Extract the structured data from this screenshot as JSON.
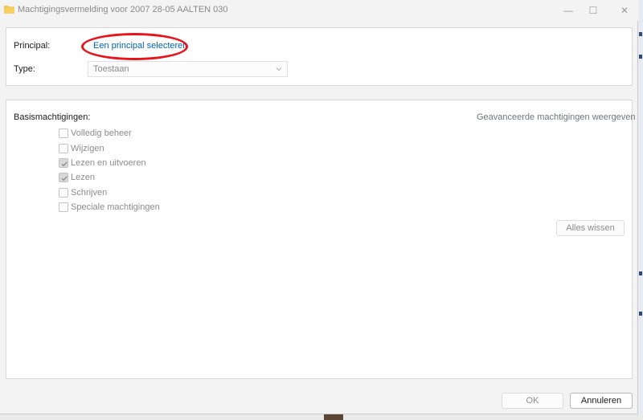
{
  "window": {
    "title": "Machtigingsvermelding voor 2007 28-05 AALTEN 030",
    "minimize_glyph": "—",
    "maximize_glyph": "☐",
    "close_glyph": "✕"
  },
  "principal": {
    "label": "Principal:",
    "link": "Een principal selecteren"
  },
  "type": {
    "label": "Type:",
    "value": "Toestaan"
  },
  "permissions": {
    "heading": "Basismachtigingen:",
    "advanced_link": "Geavanceerde machtigingen weergeven",
    "items": [
      {
        "label": "Volledig beheer",
        "checked": false
      },
      {
        "label": "Wijzigen",
        "checked": false
      },
      {
        "label": "Lezen en uitvoeren",
        "checked": true
      },
      {
        "label": "Lezen",
        "checked": true
      },
      {
        "label": "Schrijven",
        "checked": false
      },
      {
        "label": "Speciale machtigingen",
        "checked": false
      }
    ],
    "clear_button": "Alles wissen"
  },
  "footer": {
    "ok_label": "OK",
    "cancel_label": "Annuleren"
  },
  "colors": {
    "link": "#0063b1",
    "annotation": "#e8141b",
    "folder": "#f2c14e"
  },
  "icons": {
    "title": "folder-icon",
    "select": "chevron-down-icon",
    "checkmark": "checkmark-icon"
  }
}
